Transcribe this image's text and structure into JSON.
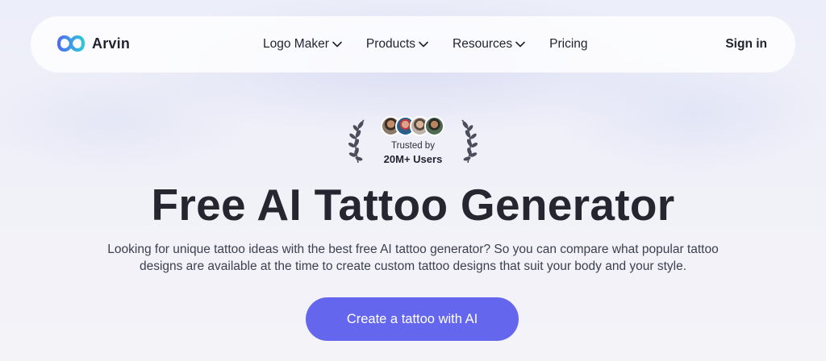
{
  "brand": {
    "name": "Arvin",
    "logo_icon": "infinity-logo-icon"
  },
  "nav": {
    "items": [
      {
        "label": "Logo Maker",
        "has_dropdown": true
      },
      {
        "label": "Products",
        "has_dropdown": true
      },
      {
        "label": "Resources",
        "has_dropdown": true
      },
      {
        "label": "Pricing",
        "has_dropdown": false
      }
    ],
    "signin_label": "Sign in"
  },
  "trust": {
    "label": "Trusted by",
    "count": "20M+ Users"
  },
  "hero": {
    "title": "Free AI Tattoo Generator",
    "description": "Looking for unique tattoo ideas with the best free AI tattoo generator? So you can compare what popular tattoo designs are available at the time to create custom tattoo designs that suit your body and your style.",
    "cta_label": "Create a tattoo with AI"
  },
  "colors": {
    "accent": "#6466ee",
    "logo_gradient_start": "#4f6df0",
    "logo_gradient_end": "#2ec8d8",
    "text_dark": "#242630"
  }
}
